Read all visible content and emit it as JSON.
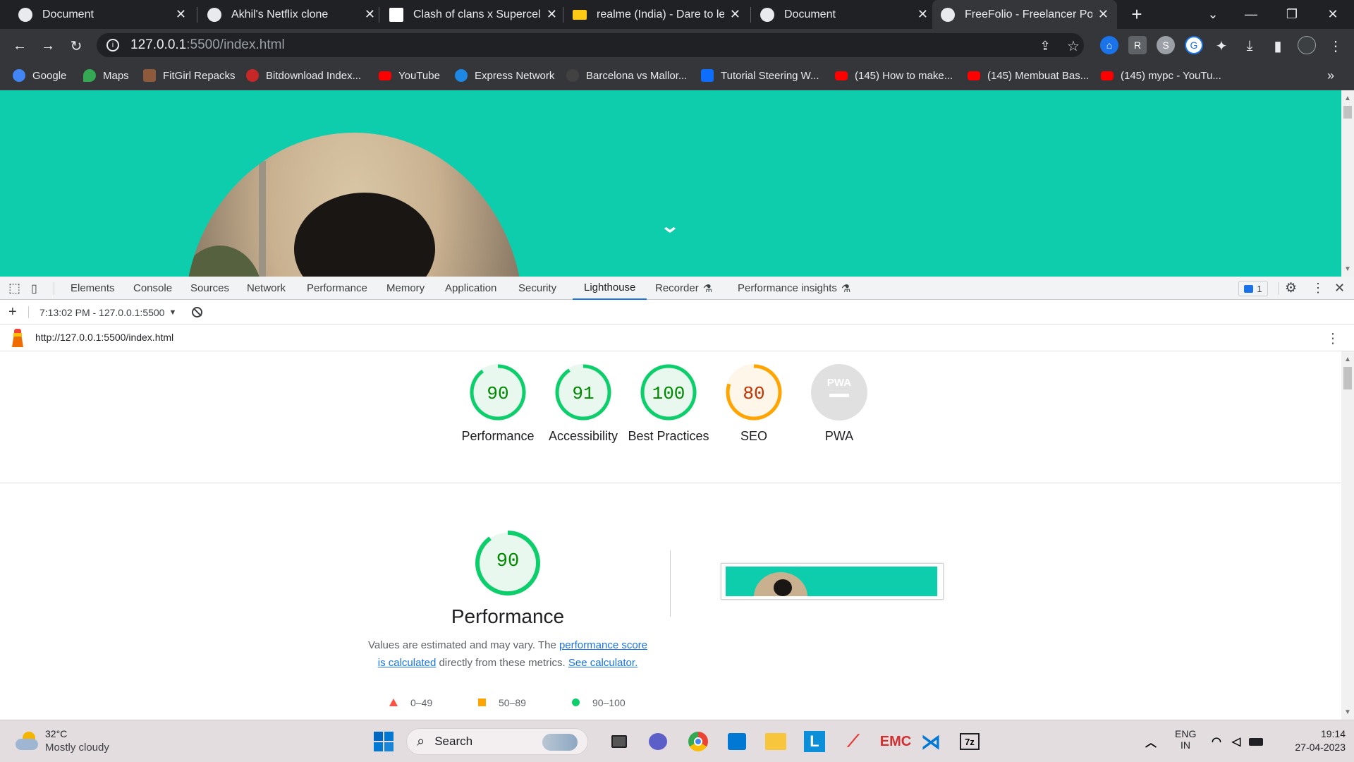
{
  "tabs": [
    {
      "title": "Document",
      "favicon": "globe-icon"
    },
    {
      "title": "Akhil's Netflix clone",
      "favicon": "globe-icon"
    },
    {
      "title": "Clash of clans x Supercell",
      "favicon": "supercell-icon"
    },
    {
      "title": "realme (India) - Dare to leap",
      "favicon": "realme-icon"
    },
    {
      "title": "Document",
      "favicon": "globe-icon"
    },
    {
      "title": "FreeFolio - Freelancer Portf",
      "favicon": "globe-icon",
      "active": true
    }
  ],
  "address_bar": {
    "host": "127.0.0.1",
    "path": ":5500/index.html"
  },
  "bookmarks": [
    {
      "label": "Google",
      "color": "#4285f4"
    },
    {
      "label": "Maps",
      "color": "#34a853"
    },
    {
      "label": "FitGirl Repacks",
      "color": "#8d5a3b"
    },
    {
      "label": "Bitdownload Index...",
      "color": "#c62828"
    },
    {
      "label": "YouTube",
      "color": "#ff0000"
    },
    {
      "label": "Express Network",
      "color": "#1e88e5"
    },
    {
      "label": "Barcelona vs Mallor...",
      "color": "#424242"
    },
    {
      "label": "Tutorial Steering W...",
      "color": "#0d6efd"
    },
    {
      "label": "(145) How to make...",
      "color": "#ff0000"
    },
    {
      "label": "(145) Membuat Bas...",
      "color": "#ff0000"
    },
    {
      "label": "(145) mypc - YouTu...",
      "color": "#ff0000"
    }
  ],
  "page": {
    "accent": "#0ecdac"
  },
  "devtools": {
    "tabs": [
      "Elements",
      "Console",
      "Sources",
      "Network",
      "Performance",
      "Memory",
      "Application",
      "Security",
      "Lighthouse",
      "Recorder",
      "Performance insights"
    ],
    "active_tab": "Lighthouse",
    "issues_count": "1",
    "report_selector": "7:13:02 PM - 127.0.0.1:5500",
    "report_url": "http://127.0.0.1:5500/index.html"
  },
  "lighthouse": {
    "scores": [
      {
        "label": "Performance",
        "value": 90,
        "status": "pass"
      },
      {
        "label": "Accessibility",
        "value": 91,
        "status": "pass"
      },
      {
        "label": "Best Practices",
        "value": 100,
        "status": "pass"
      },
      {
        "label": "SEO",
        "value": 80,
        "status": "average"
      },
      {
        "label": "PWA",
        "value": null,
        "status": "na"
      }
    ],
    "pwa_badge": "PWA",
    "detail": {
      "score": "90",
      "title": "Performance",
      "desc_part1": "Values are estimated and may vary. The ",
      "link1": "performance score is calculated",
      "desc_part2": " directly from these metrics. ",
      "link2": "See calculator."
    },
    "legend": [
      {
        "range": "0–49",
        "color": "#ff4e42"
      },
      {
        "range": "50–89",
        "color": "#ffa400"
      },
      {
        "range": "90–100",
        "color": "#0cce6b"
      }
    ]
  },
  "taskbar": {
    "weather_temp": "32°C",
    "weather_desc": "Mostly cloudy",
    "search_label": "Search",
    "lang_top": "ENG",
    "lang_bottom": "IN",
    "time": "19:14",
    "date": "27-04-2023"
  }
}
